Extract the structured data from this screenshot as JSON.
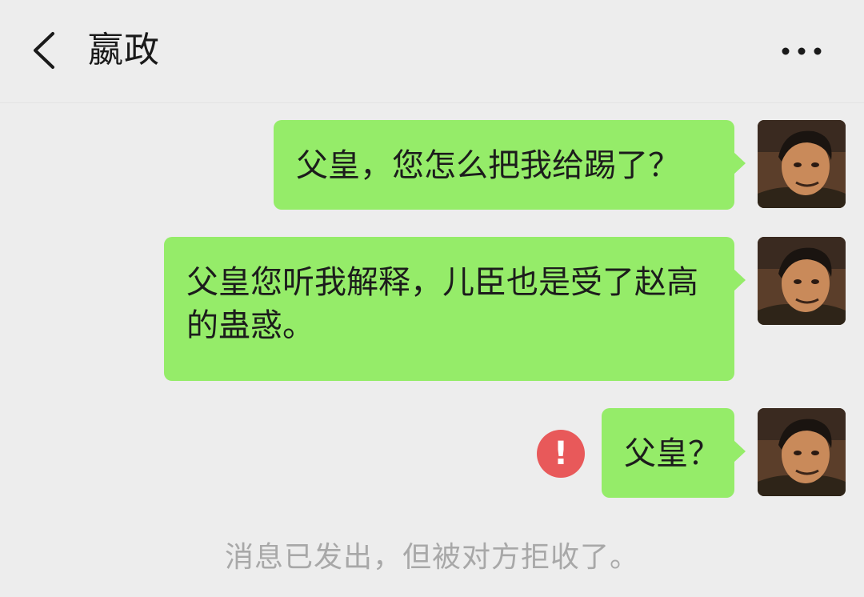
{
  "header": {
    "title": "嬴政",
    "back_icon": "chevron-left-icon",
    "more_icon": "more-horizontal-icon"
  },
  "messages": [
    {
      "text": "父皇，您怎么把我给踢了？",
      "status": "sent"
    },
    {
      "text": "父皇您听我解释，儿臣也是受了赵高的蛊惑。",
      "status": "sent"
    },
    {
      "text": "父皇？",
      "status": "failed"
    }
  ],
  "error_icon": {
    "glyph": "!",
    "color": "#e8595a"
  },
  "system_notice": "消息已发出，但被对方拒收了。",
  "colors": {
    "background": "#ededed",
    "bubble": "#95ec69",
    "error": "#e8595a",
    "system_text": "#a8a8a8"
  }
}
